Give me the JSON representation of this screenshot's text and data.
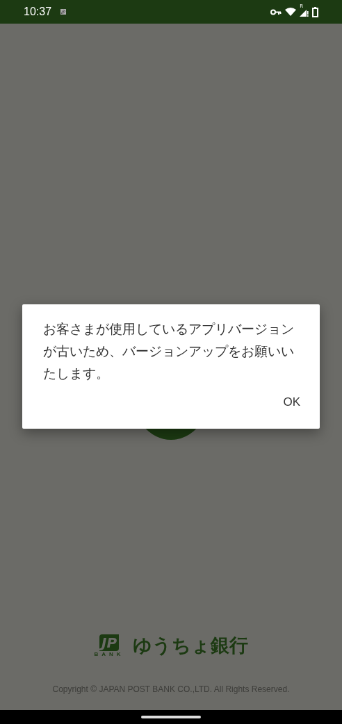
{
  "status_bar": {
    "time": "10:37",
    "signal_label": "R"
  },
  "background": {
    "brand": {
      "mark": "JP",
      "mark_caption": "BANK",
      "name": "ゆうちょ銀行"
    },
    "copyright": "Copyright © JAPAN POST BANK CO.,LTD. All Rights Reserved."
  },
  "dialog": {
    "message": "お客さまが使用しているアプリバージョンが古いため、バージョンアップをお願いいたします。",
    "buttons": [
      "OK"
    ]
  }
}
